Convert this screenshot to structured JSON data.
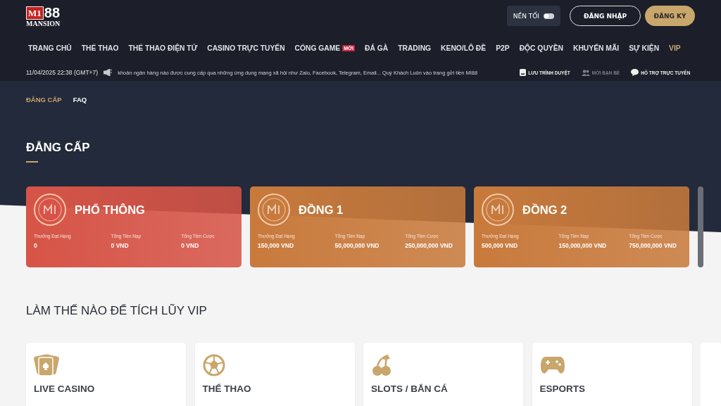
{
  "logo": {
    "mark": "M1",
    "number": "88",
    "tagline": "MANSION"
  },
  "header": {
    "dark_mode": {
      "label": "NỀN TỐI",
      "on": false
    },
    "login": "ĐĂNG NHẬP",
    "register": "ĐĂNG KÝ"
  },
  "nav": [
    {
      "label": "TRANG CHỦ",
      "selected": false
    },
    {
      "label": "THỂ THAO",
      "selected": false
    },
    {
      "label": "THỂ THAO ĐIỆN TỬ",
      "selected": false
    },
    {
      "label": "CASINO TRỰC TUYẾN",
      "selected": false
    },
    {
      "label": "CỔNG GAME",
      "badge": "MỚI",
      "selected": false
    },
    {
      "label": "ĐÁ GÀ",
      "selected": false
    },
    {
      "label": "TRADING",
      "selected": false
    },
    {
      "label": "KENO/LÔ ĐỀ",
      "selected": false
    },
    {
      "label": "P2P",
      "selected": false
    },
    {
      "label": "ĐỘC QUYỀN",
      "selected": false
    },
    {
      "label": "KHUYẾN MÃI",
      "selected": false
    },
    {
      "label": "SỰ KIỆN",
      "selected": false
    },
    {
      "label": "VIP",
      "selected": true
    }
  ],
  "ticker": {
    "datetime": "11/04/2025 22:38 (GMT+7)",
    "message": "khoản ngân hàng nào được cung cấp qua những ứng dụng mạng xã hội như Zalo, Facebook, Telegram, Email... Quý Khách Luôn vào trang gửi tiền MI88"
  },
  "quick_links": [
    {
      "kind": "bookmark",
      "label": "LƯU TRÌNH DUYỆT",
      "disabled": false
    },
    {
      "kind": "friends",
      "label": "MỜI BẠN BÈ",
      "disabled": true
    },
    {
      "kind": "chat",
      "label": "HỖ TRỢ TRỰC TUYẾN",
      "disabled": false
    }
  ],
  "subtabs": [
    {
      "label": "ĐẲNG CẤP",
      "selected": true
    },
    {
      "label": "FAQ",
      "selected": false
    }
  ],
  "tiers_title": "ĐẲNG CẤP",
  "tiers": [
    {
      "name": "PHỔ THÔNG",
      "color": "#d65447",
      "stats": [
        {
          "label": "Thưởng Đạt Hạng",
          "value": "0"
        },
        {
          "label": "Tổng Tiền Nạp",
          "value": "0 VND"
        },
        {
          "label": "Tổng Tiền Cược",
          "value": "0 VND"
        }
      ]
    },
    {
      "name": "ĐỒNG 1",
      "color": "#c87a3c",
      "stats": [
        {
          "label": "Thưởng Đạt Hạng",
          "value": "150,000 VND"
        },
        {
          "label": "Tổng Tiền Nạp",
          "value": "50,000,000 VND"
        },
        {
          "label": "Tổng Tiền Cược",
          "value": "250,000,000 VND"
        }
      ]
    },
    {
      "name": "ĐỒNG 2",
      "color": "#c87a3c",
      "stats": [
        {
          "label": "Thưởng Đạt Hạng",
          "value": "500,000 VND"
        },
        {
          "label": "Tổng Tiền Nạp",
          "value": "150,000,000 VND"
        },
        {
          "label": "Tổng Tiền Cược",
          "value": "750,000,000 VND"
        }
      ]
    }
  ],
  "accumulate_title": "LÀM THẾ NÀO ĐỂ TÍCH LŨY VIP",
  "categories": [
    {
      "kind": "cards",
      "label": "LIVE CASINO"
    },
    {
      "kind": "ball",
      "label": "THỂ THAO"
    },
    {
      "kind": "cherry",
      "label": "SLOTS / BẮN CÁ"
    },
    {
      "kind": "gamepad",
      "label": "ESPORTS"
    }
  ]
}
